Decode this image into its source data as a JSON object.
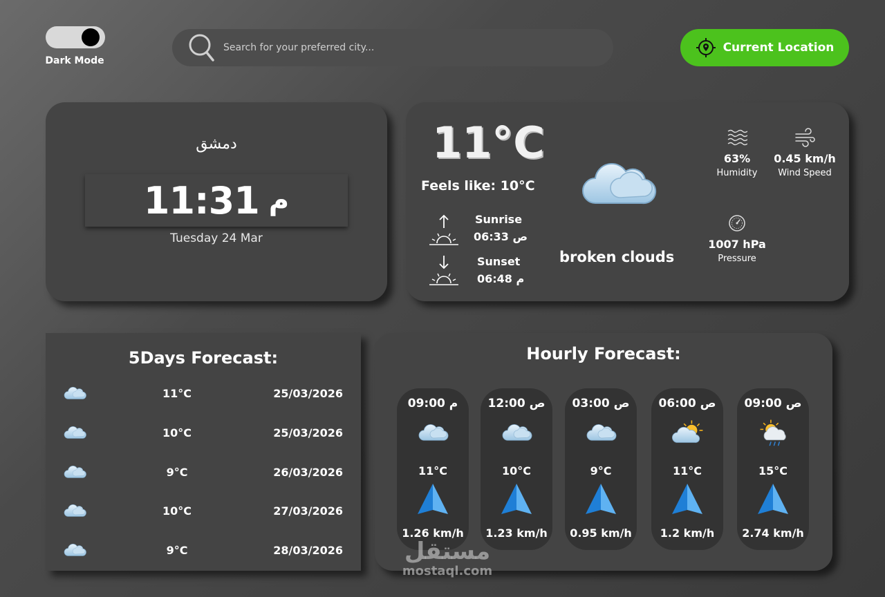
{
  "header": {
    "dark_mode_label": "Dark Mode",
    "search_placeholder": "Search for your preferred city...",
    "current_location_label": "Current Location",
    "accent_color": "#4cc21d"
  },
  "city_card": {
    "city": "دمشق",
    "time": "11:31",
    "ampm": "م",
    "date": "Tuesday 24 Mar"
  },
  "current": {
    "temperature": "11°C",
    "feels_like": "Feels like: 10°C",
    "sunrise_label": "Sunrise",
    "sunrise_time": "06:33 ص",
    "sunset_label": "Sunset",
    "sunset_time": "06:48 م",
    "description": "broken clouds",
    "icon": "broken-clouds-icon",
    "humidity_value": "63%",
    "humidity_label": "Humidity",
    "wind_value": "0.45 km/h",
    "wind_label": "Wind Speed",
    "pressure_value": "1007 hPa",
    "pressure_label": "Pressure"
  },
  "five_days": {
    "title": "5Days Forecast:",
    "days": [
      {
        "icon": "cloud-icon",
        "temp": "11°C",
        "date": "25/03/2026"
      },
      {
        "icon": "cloud-icon",
        "temp": "10°C",
        "date": "25/03/2026"
      },
      {
        "icon": "cloud-icon",
        "temp": "9°C",
        "date": "26/03/2026"
      },
      {
        "icon": "cloud-icon",
        "temp": "10°C",
        "date": "27/03/2026"
      },
      {
        "icon": "cloud-icon",
        "temp": "9°C",
        "date": "28/03/2026"
      }
    ]
  },
  "hourly": {
    "title": "Hourly Forecast:",
    "hours": [
      {
        "time": "09:00 م",
        "icon": "cloud-icon",
        "temp": "11°C",
        "wind": "1.26 km/h"
      },
      {
        "time": "12:00 ص",
        "icon": "cloud-icon",
        "temp": "10°C",
        "wind": "1.23 km/h"
      },
      {
        "time": "03:00 ص",
        "icon": "cloud-icon",
        "temp": "9°C",
        "wind": "0.95 km/h"
      },
      {
        "time": "06:00 ص",
        "icon": "sun-cloud-icon",
        "temp": "11°C",
        "wind": "1.2 km/h"
      },
      {
        "time": "09:00 ص",
        "icon": "sun-rain-icon",
        "temp": "15°C",
        "wind": "2.74 km/h"
      }
    ]
  },
  "watermark": {
    "arabic": "مستقل",
    "latin": "mostaql.com"
  }
}
